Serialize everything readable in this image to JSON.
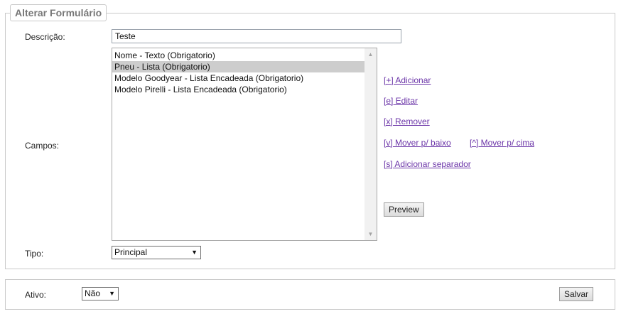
{
  "form": {
    "legend": "Alterar Formulário",
    "descricao_label": "Descrição:",
    "descricao_value": "Teste",
    "campos_label": "Campos:",
    "campos_items": [
      "Nome - Texto (Obrigatorio)",
      "Pneu - Lista (Obrigatorio)",
      "Modelo Goodyear - Lista Encadeada (Obrigatorio)",
      "Modelo Pirelli - Lista Encadeada (Obrigatorio)"
    ],
    "selected_item": "Pneu - Lista (Obrigatorio)",
    "tipo_label": "Tipo:",
    "tipo_value": "Principal"
  },
  "actions": {
    "adicionar": "[+] Adicionar",
    "editar": "[e] Editar",
    "remover": "[x] Remover",
    "mover_baixo": "[v] Mover p/ baixo",
    "mover_cima": "[^] Mover p/ cima",
    "adicionar_separador": "[s] Adicionar separador",
    "preview": "Preview"
  },
  "bottom": {
    "ativo_label": "Ativo:",
    "ativo_value": "Não",
    "salvar": "Salvar"
  },
  "icons": {
    "scroll_up": "scroll-up-arrow-icon",
    "scroll_down": "scroll-down-arrow-icon",
    "dropdown": "caret-down-icon"
  },
  "colors": {
    "link": "#6b35a8",
    "selection": "#cdcdcd",
    "legend_text": "#777777",
    "border": "#c9c9c9"
  }
}
